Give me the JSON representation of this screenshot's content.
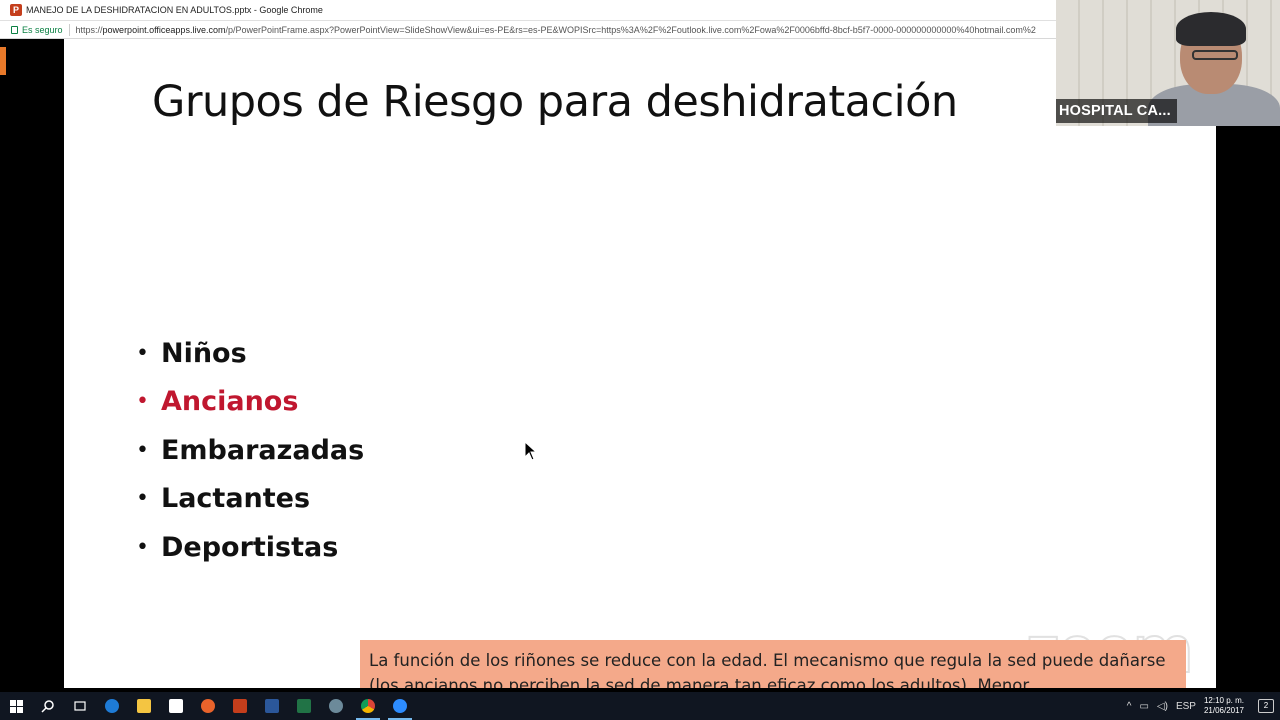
{
  "browser": {
    "window_title": "MANEJO DE LA DESHIDRATACION EN ADULTOS.pptx - Google Chrome",
    "secure_label": "Es seguro",
    "url_scheme": "https://",
    "url_host": "powerpoint.officeapps.live.com",
    "url_path": "/p/PowerPointFrame.aspx?PowerPointView=SlideShowView&ui=es-PE&rs=es-PE&WOPISrc=https%3A%2F%2Foutlook.live.com%2Fowa%2F0006bffd-8bcf-b5f7-0000-000000000000%40hotmail.com%2"
  },
  "slide": {
    "title": "Grupos de Riesgo para deshidratación",
    "bullets": [
      {
        "text": "Niños",
        "highlight": false
      },
      {
        "text": "Ancianos",
        "highlight": true
      },
      {
        "text": "Embarazadas",
        "highlight": false
      },
      {
        "text": "Lactantes",
        "highlight": false
      },
      {
        "text": "Deportistas",
        "highlight": false
      }
    ],
    "highlight_color": "#c0172f",
    "subtitle": "La función de los riñones se reduce con la edad. El mecanismo que regula la sed puede dañarse (los ancianos no perciben la sed de manera tan eficaz como los adultos). Menor"
  },
  "video": {
    "participant_name": "HOSPITAL CA..."
  },
  "watermark": "zoom",
  "taskbar": {
    "icons": [
      "windows-start-icon",
      "search-icon",
      "task-view-icon",
      "edge-icon",
      "file-explorer-icon",
      "store-icon",
      "firefox-icon",
      "powerpoint-icon",
      "word-icon",
      "excel-icon",
      "settings-icon",
      "chrome-icon",
      "zoom-icon"
    ],
    "language": "ESP",
    "time": "12:10 p. m.",
    "date": "21/06/2017",
    "notification_count": "2"
  }
}
